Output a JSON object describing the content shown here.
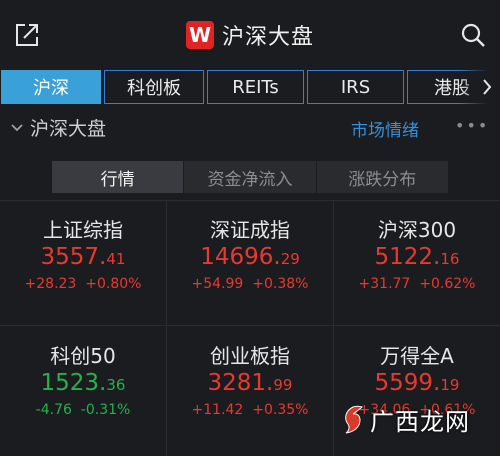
{
  "header": {
    "title": "沪深大盘",
    "logo_letter": "W",
    "share_icon": "share-icon",
    "search_icon": "search-icon"
  },
  "tabs": [
    {
      "label": "沪深",
      "active": true
    },
    {
      "label": "科创板",
      "active": false
    },
    {
      "label": "REITs",
      "active": false
    },
    {
      "label": "IRS",
      "active": false
    },
    {
      "label": "港股",
      "active": false
    }
  ],
  "section": {
    "title": "沪深大盘",
    "link": "市场情绪",
    "more": "•••"
  },
  "segments": [
    {
      "label": "行情",
      "active": true
    },
    {
      "label": "资金净流入",
      "active": false
    },
    {
      "label": "涨跌分布",
      "active": false
    }
  ],
  "indices": [
    {
      "name": "上证综指",
      "price_int": "3557.",
      "price_dec": "41",
      "change": "+28.23",
      "pct": "+0.80%",
      "trend": "up"
    },
    {
      "name": "深证成指",
      "price_int": "14696.",
      "price_dec": "29",
      "change": "+54.99",
      "pct": "+0.38%",
      "trend": "up"
    },
    {
      "name": "沪深300",
      "price_int": "5122.",
      "price_dec": "16",
      "change": "+31.77",
      "pct": "+0.62%",
      "trend": "up"
    },
    {
      "name": "科创50",
      "price_int": "1523.",
      "price_dec": "36",
      "change": "-4.76",
      "pct": "-0.31%",
      "trend": "down"
    },
    {
      "name": "创业板指",
      "price_int": "3281.",
      "price_dec": "99",
      "change": "+11.42",
      "pct": "+0.35%",
      "trend": "up"
    },
    {
      "name": "万得全A",
      "price_int": "5599.",
      "price_dec": "19",
      "change": "+34.06",
      "pct": "+0.61%",
      "trend": "up"
    }
  ],
  "watermark": {
    "text": "广西龙网"
  },
  "colors": {
    "up": "#e8392e",
    "down": "#26b14a",
    "accent": "#3aa0d8",
    "logo": "#e02424"
  }
}
